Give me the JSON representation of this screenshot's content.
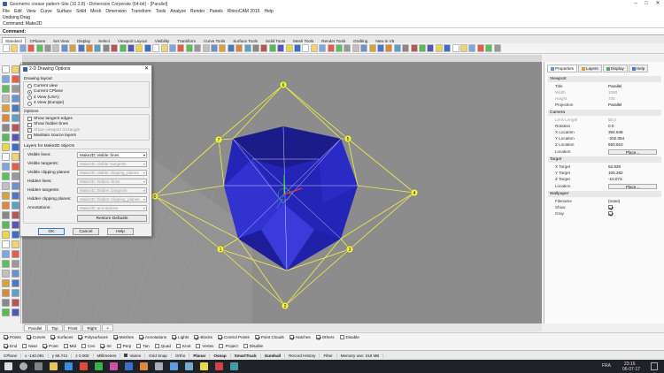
{
  "window": {
    "title": "Geometric crease pattern-Site (10.3.8) - Dimension Corporate (64-bit) - [Parallel]"
  },
  "menu": [
    "File",
    "Edit",
    "View",
    "Curve",
    "Surface",
    "Solid",
    "Mesh",
    "Dimension",
    "Transform",
    "Tools",
    "Analyze",
    "Render",
    "Panels",
    "RhinoCAM 2015",
    "Help"
  ],
  "command_history": [
    "Undoing Drag",
    "Command: Make2D"
  ],
  "command_prompt": "Command:",
  "toolbar_tabs": [
    "Standard",
    "CPlanes",
    "Set View",
    "Display",
    "Select",
    "Viewport Layout",
    "Visibility",
    "Transform",
    "Curve Tools",
    "Surface Tools",
    "Solid Tools",
    "Mesh Tools",
    "Render Tools",
    "Drafting",
    "New in V5"
  ],
  "active_toolbar_tab": "Standard",
  "view_tabs": [
    "Parallel",
    "Top",
    "Front",
    "Right",
    "+"
  ],
  "osnaps": [
    {
      "label": "Points",
      "on": true
    },
    {
      "label": "Curves",
      "on": true
    },
    {
      "label": "Surfaces",
      "on": true
    },
    {
      "label": "Polysurfaces",
      "on": true
    },
    {
      "label": "Meshes",
      "on": true
    },
    {
      "label": "Annotations",
      "on": true
    },
    {
      "label": "Lights",
      "on": true
    },
    {
      "label": "Blocks",
      "on": true
    },
    {
      "label": "Control Points",
      "on": true
    },
    {
      "label": "Point Clouds",
      "on": true
    },
    {
      "label": "Hatches",
      "on": true
    },
    {
      "label": "Others",
      "on": true
    },
    {
      "label": "Disable",
      "on": false
    }
  ],
  "osnaps2": [
    {
      "label": "End",
      "on": true
    },
    {
      "label": "Near",
      "on": false
    },
    {
      "label": "Point",
      "on": true
    },
    {
      "label": "Mid",
      "on": false
    },
    {
      "label": "Cen",
      "on": false
    },
    {
      "label": "Int",
      "on": true
    },
    {
      "label": "Perp",
      "on": false
    },
    {
      "label": "Tan",
      "on": false
    },
    {
      "label": "Quad",
      "on": false
    },
    {
      "label": "Knot",
      "on": false
    },
    {
      "label": "Vertex",
      "on": false
    },
    {
      "label": "Project",
      "on": false
    },
    {
      "label": "Disable",
      "on": false
    }
  ],
  "status": {
    "cplane": "CPlane",
    "x": "x -140.091",
    "y": "y 66.741",
    "z": "z 0.000",
    "units": "Millimeters",
    "layer": "Varies",
    "grid_snap": "Grid Snap",
    "ortho": "Ortho",
    "planar": "Planar",
    "osnap": "Osnap",
    "smarttrack": "SmartTrack",
    "gumball": "Gumball",
    "record_history": "Record History",
    "filter": "Filter",
    "memory": "Memory use: 318 MB"
  },
  "taskbar": {
    "time": "23:16",
    "date": "06-07-17",
    "lang": "FRA"
  },
  "right_panel": {
    "tabs": [
      "Properties",
      "Layers",
      "Display",
      "Help"
    ],
    "active_tab": "Properties",
    "viewport_section": "Viewport",
    "title_k": "Title",
    "title_v": "Parallel",
    "width_k": "Width",
    "width_v": "1080",
    "height_k": "Height",
    "height_v": "735",
    "projection_k": "Projection",
    "projection_v": "Parallel",
    "camera_section": "Camera",
    "lens_k": "Lens Length",
    "lens_v": "50.0",
    "rotation_k": "Rotation",
    "rotation_v": "0.0",
    "xloc_k": "X Location",
    "xloc_v": "394.648",
    "yloc_k": "Y Location",
    "yloc_v": "-202.054",
    "zloc_k": "Z Location",
    "zloc_v": "650.910",
    "loc_k": "Location",
    "place_label": "Place...",
    "target_section": "Target",
    "xt_k": "X Target",
    "xt_v": "52.926",
    "yt_k": "Y Target",
    "yt_v": "105.282",
    "zt_k": "Z Target",
    "zt_v": "-10.071",
    "tloc_k": "Location",
    "tplace_label": "Place...",
    "wallpaper_section": "Wallpaper",
    "filename_k": "Filename",
    "filename_v": "(none)",
    "show_k": "Show",
    "gray_k": "Gray"
  },
  "dialog": {
    "title": "2-D Drawing Options",
    "layout_label": "Drawing layout",
    "layout_options": [
      "Current view",
      "Current CPlane",
      "4 View (USA)",
      "4 View (Europe)"
    ],
    "layout_selected": 1,
    "options_label": "Options",
    "options": [
      "Show tangent edges",
      "Show hidden lines",
      "Show viewport rectangle",
      "Maintain source layers"
    ],
    "layers_label": "Layers for Make2D objects",
    "rows": [
      {
        "k": "Visible lines:",
        "v": "Make2D::visible::lines",
        "dis": false
      },
      {
        "k": "Visible tangents:",
        "v": "Make2D::visible::tangents",
        "dis": true
      },
      {
        "k": "Visible clipping planes:",
        "v": "Make2D::visible::clipping_planes",
        "dis": true
      },
      {
        "k": "Hidden lines:",
        "v": "Make2D::hidden::lines",
        "dis": true
      },
      {
        "k": "Hidden tangents:",
        "v": "Make2D::hidden::tangents",
        "dis": true
      },
      {
        "k": "Hidden clipping planes:",
        "v": "Make2D::hidden::clipping_planes",
        "dis": true
      },
      {
        "k": "Annotations:",
        "v": "Make2D::annotations",
        "dis": true
      }
    ],
    "restore_label": "Restore Defaults",
    "ok_label": "OK",
    "cancel_label": "Cancel",
    "help_label": "Help"
  },
  "points": [
    {
      "id": "point-6",
      "label": "6"
    },
    {
      "id": "point-7",
      "label": "7"
    },
    {
      "id": "point-5",
      "label": "5"
    },
    {
      "id": "point-0",
      "label": "0"
    },
    {
      "id": "point-4",
      "label": "4"
    },
    {
      "id": "point-1",
      "label": "1"
    },
    {
      "id": "point-3",
      "label": "3"
    },
    {
      "id": "point-2",
      "label": "2"
    }
  ],
  "colors": {
    "viewport_bg": "#8c8c8c",
    "shape_dark": "#1b1b8a",
    "shape_mid": "#2323b8",
    "shape_light": "#3b3bdc",
    "wire": "#f2f04a",
    "dialog_accent": "#3a76c8"
  }
}
